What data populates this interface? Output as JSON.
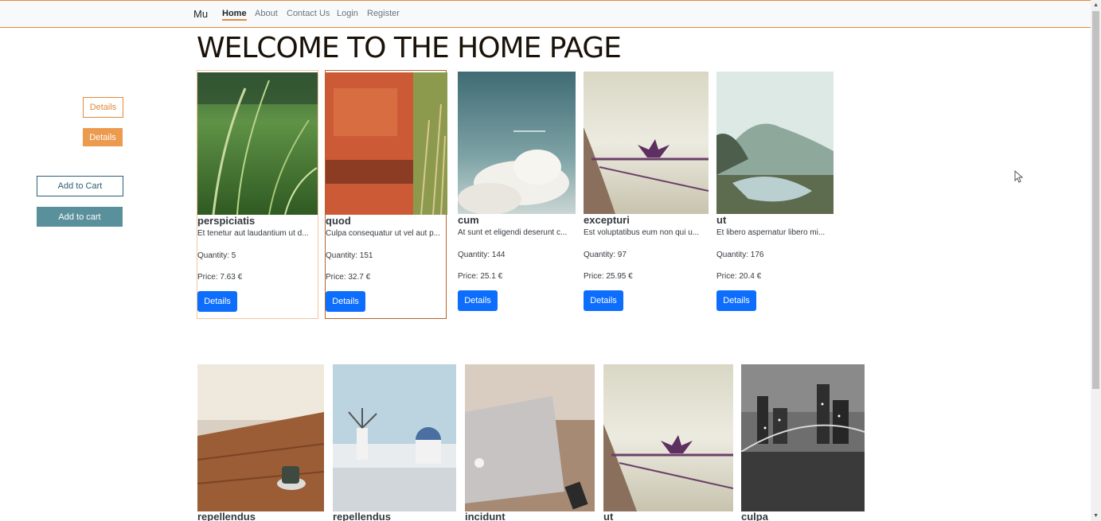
{
  "navbar": {
    "brand": "Mu",
    "links": [
      "Home",
      "About",
      "Contact Us",
      "Login",
      "Register"
    ]
  },
  "page_title": "WELCOME TO THE HOME PAGE",
  "demo_buttons": {
    "details_outline": "Details",
    "details_filled": "Details",
    "add_to_cart_outline": "Add to Cart",
    "add_to_cart_filled": "Add to cart"
  },
  "products_row1": [
    {
      "name": "perspiciatis",
      "desc": "Et tenetur aut laudantium ut d...",
      "quantity": "Quantity: 5",
      "price": "Price: 7.63 €",
      "button": "Details",
      "image": "grass-photo"
    },
    {
      "name": "quod",
      "desc": "Culpa consequatur ut vel aut p...",
      "quantity": "Quantity: 151",
      "price": "Price: 32.7 €",
      "button": "Details",
      "image": "red-wall-photo"
    },
    {
      "name": "cum",
      "desc": "At sunt et eligendi deserunt c...",
      "quantity": "Quantity: 144",
      "price": "Price: 25.1 €",
      "button": "Details",
      "image": "cloud-sky-photo"
    },
    {
      "name": "excepturi",
      "desc": "Est voluptatibus eum non qui u...",
      "quantity": "Quantity: 97",
      "price": "Price: 25.95 €",
      "button": "Details",
      "image": "bird-on-rope-photo"
    },
    {
      "name": "ut",
      "desc": "Et libero aspernatur libero mi...",
      "quantity": "Quantity: 176",
      "price": "Price: 20.4 €",
      "button": "Details",
      "image": "river-landscape-photo"
    }
  ],
  "products_row2": [
    {
      "name": "repellendus",
      "image": "cafe-table-photo"
    },
    {
      "name": "repellendus",
      "image": "windmill-town-photo"
    },
    {
      "name": "incidunt",
      "image": "laptop-photo"
    },
    {
      "name": "ut",
      "image": "bird-on-rope-photo"
    },
    {
      "name": "culpa",
      "image": "city-bridge-photo"
    }
  ],
  "colors": {
    "accent_orange": "#e08a3c",
    "primary_blue": "#0d6efd",
    "teal": "#5a8f9c"
  }
}
